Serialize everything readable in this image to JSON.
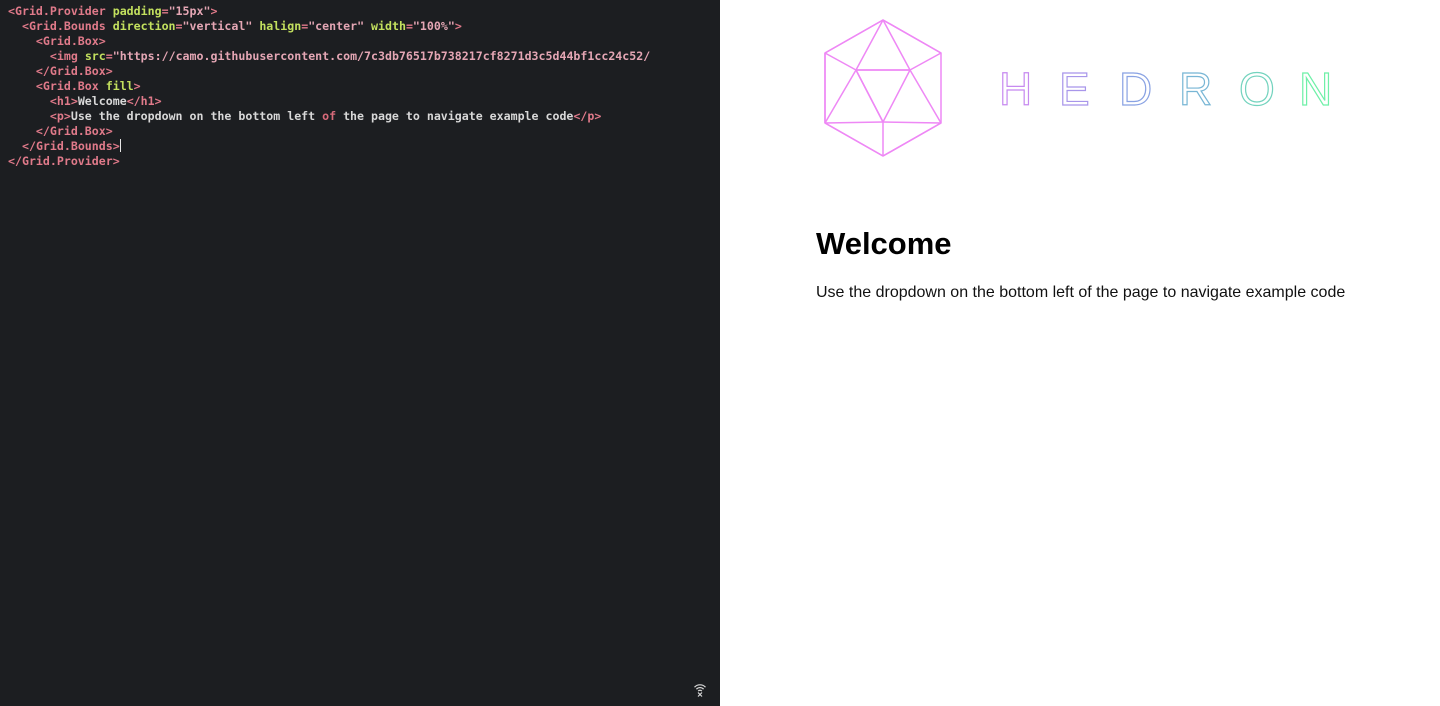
{
  "editor": {
    "lines": [
      [
        [
          "t-punct",
          "<"
        ],
        [
          "t-tag",
          "Grid.Provider"
        ],
        [
          "t-text",
          " "
        ],
        [
          "t-attr",
          "padding"
        ],
        [
          "t-punct",
          "="
        ],
        [
          "t-str",
          "\"15px\""
        ],
        [
          "t-punct",
          ">"
        ]
      ],
      [
        [
          "t-text",
          "  "
        ],
        [
          "t-punct",
          "<"
        ],
        [
          "t-tag",
          "Grid.Bounds"
        ],
        [
          "t-text",
          " "
        ],
        [
          "t-attr",
          "direction"
        ],
        [
          "t-punct",
          "="
        ],
        [
          "t-str",
          "\"vertical\""
        ],
        [
          "t-text",
          " "
        ],
        [
          "t-attr",
          "halign"
        ],
        [
          "t-punct",
          "="
        ],
        [
          "t-str",
          "\"center\""
        ],
        [
          "t-text",
          " "
        ],
        [
          "t-attr",
          "width"
        ],
        [
          "t-punct",
          "="
        ],
        [
          "t-str",
          "\"100%\""
        ],
        [
          "t-punct",
          ">"
        ]
      ],
      [
        [
          "t-text",
          "    "
        ],
        [
          "t-punct",
          "<"
        ],
        [
          "t-tag",
          "Grid.Box"
        ],
        [
          "t-punct",
          ">"
        ]
      ],
      [
        [
          "t-text",
          "      "
        ],
        [
          "t-punct",
          "<"
        ],
        [
          "t-tag",
          "img"
        ],
        [
          "t-text",
          " "
        ],
        [
          "t-attr",
          "src"
        ],
        [
          "t-punct",
          "="
        ],
        [
          "t-str",
          "\"https://camo.githubusercontent.com/7c3db76517b738217cf8271d3c5d44bf1cc24c52/"
        ]
      ],
      [
        [
          "t-text",
          "    "
        ],
        [
          "t-punct",
          "</"
        ],
        [
          "t-tag",
          "Grid.Box"
        ],
        [
          "t-punct",
          ">"
        ]
      ],
      [
        [
          "t-text",
          "    "
        ],
        [
          "t-punct",
          "<"
        ],
        [
          "t-tag",
          "Grid.Box"
        ],
        [
          "t-text",
          " "
        ],
        [
          "t-attr",
          "fill"
        ],
        [
          "t-punct",
          ">"
        ]
      ],
      [
        [
          "t-text",
          "      "
        ],
        [
          "t-punct",
          "<"
        ],
        [
          "t-tag",
          "h1"
        ],
        [
          "t-punct",
          ">"
        ],
        [
          "t-text",
          "Welcome"
        ],
        [
          "t-punct",
          "</"
        ],
        [
          "t-tag",
          "h1"
        ],
        [
          "t-punct",
          ">"
        ]
      ],
      [
        [
          "t-text",
          "      "
        ],
        [
          "t-punct",
          "<"
        ],
        [
          "t-tag",
          "p"
        ],
        [
          "t-punct",
          ">"
        ],
        [
          "t-text",
          "Use the dropdown on the bottom left "
        ],
        [
          "t-kw",
          "of"
        ],
        [
          "t-text",
          " the page to navigate example code"
        ],
        [
          "t-punct",
          "</"
        ],
        [
          "t-tag",
          "p"
        ],
        [
          "t-punct",
          ">"
        ]
      ],
      [
        [
          "t-text",
          "    "
        ],
        [
          "t-punct",
          "</"
        ],
        [
          "t-tag",
          "Grid.Box"
        ],
        [
          "t-punct",
          ">"
        ]
      ],
      [
        [
          "t-text",
          "  "
        ],
        [
          "t-punct",
          "</"
        ],
        [
          "t-tag",
          "Grid.Bounds"
        ],
        [
          "t-punct",
          ">"
        ],
        [
          "cursor",
          ""
        ]
      ],
      [
        [
          "t-punct",
          "</"
        ],
        [
          "t-tag",
          "Grid.Provider"
        ],
        [
          "t-punct",
          ">"
        ]
      ]
    ],
    "status_icon": "broadcast-icon"
  },
  "preview": {
    "logo": {
      "letters": [
        "H",
        "E",
        "D",
        "R",
        "O",
        "N"
      ],
      "colors": {
        "icosahedron": "#ee88f5",
        "gradient_start": "#c78af0",
        "gradient_mid": "#7aa8e0",
        "gradient_end": "#6ff0a8"
      }
    },
    "title": "Welcome",
    "intro": "Use the dropdown on the bottom left of the page to navigate example code"
  },
  "colors": {
    "editor_bg": "#1c1e21",
    "preview_bg": "#ffffff"
  }
}
